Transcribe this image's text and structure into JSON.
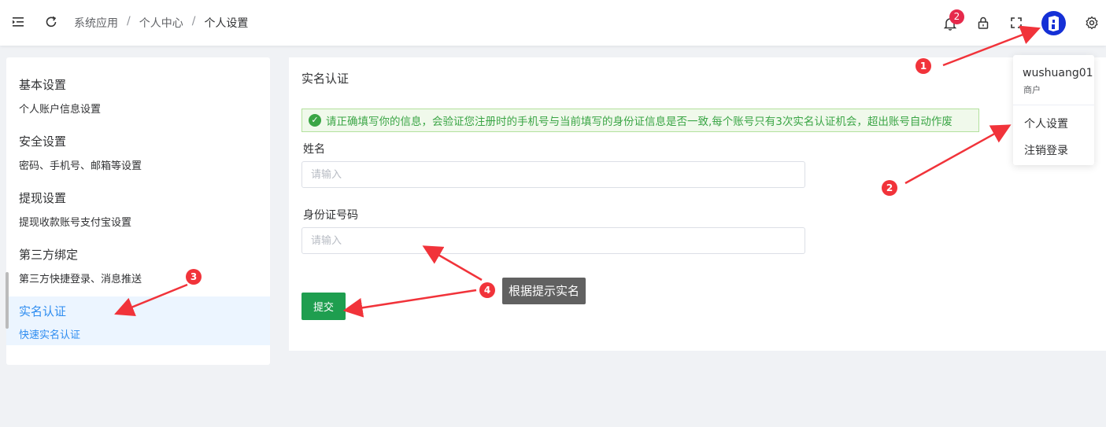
{
  "breadcrumb": [
    "系统应用",
    "个人中心",
    "个人设置"
  ],
  "breadcrumb_separator": "/",
  "notifications": {
    "count": "2"
  },
  "topbar_icons": [
    "menu-fold-icon",
    "refresh-icon",
    "bell-icon",
    "lock-icon",
    "fullscreen-icon",
    "avatar",
    "gear-icon"
  ],
  "sidebar": {
    "items": [
      {
        "title": "基本设置",
        "desc": "个人账户信息设置"
      },
      {
        "title": "安全设置",
        "desc": "密码、手机号、邮箱等设置"
      },
      {
        "title": "提现设置",
        "desc": "提现收款账号支付宝设置"
      },
      {
        "title": "第三方绑定",
        "desc": "第三方快捷登录、消息推送"
      },
      {
        "title": "实名认证",
        "desc": "快速实名认证"
      }
    ],
    "active_index": 4
  },
  "main": {
    "title": "实名认证",
    "alert": "请正确填写你的信息，会验证您注册时的手机号与当前填写的身份证信息是否一致,每个账号只有3次实名认证机会，超出账号自动作废",
    "fields": [
      {
        "label": "姓名",
        "placeholder": "请输入",
        "value": ""
      },
      {
        "label": "身份证号码",
        "placeholder": "请输入",
        "value": ""
      }
    ],
    "submit_label": "提交"
  },
  "user_menu": {
    "username": "wushuang01",
    "role": "商户",
    "items": [
      "个人设置",
      "注销登录"
    ]
  },
  "annotations": {
    "markers": [
      "1",
      "2",
      "3",
      "4"
    ],
    "tooltip": "根据提示实名"
  },
  "colors": {
    "accent": "#2d8cf0",
    "success": "#1e9e4f",
    "alert_text": "#3aa545",
    "badge": "#e6294b",
    "marker": "#f1333a"
  }
}
